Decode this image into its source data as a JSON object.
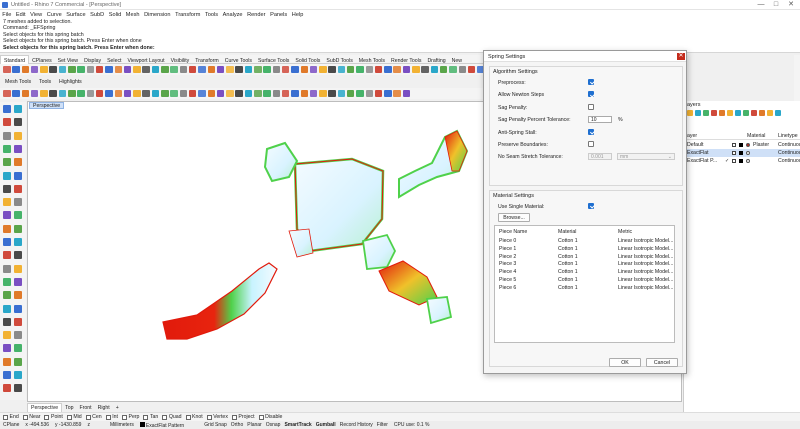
{
  "window": {
    "title": "Untitled - Rhino 7 Commercial - [Perspective]",
    "controls": [
      "—",
      "□",
      "✕"
    ]
  },
  "menu": [
    "File",
    "Edit",
    "View",
    "Curve",
    "Surface",
    "SubD",
    "Solid",
    "Mesh",
    "Dimension",
    "Transform",
    "Tools",
    "Analyze",
    "Render",
    "Panels",
    "Help"
  ],
  "command_history": [
    "7 meshes added to selection.",
    "Command: _EFSpring",
    "Select objects for this spring batch",
    "Select objects for this spring batch. Press Enter when done"
  ],
  "command_prompt": "Select objects for this spring batch. Press Enter when done:",
  "toolbar_tabs": [
    "Standard",
    "CPlanes",
    "Set View",
    "Display",
    "Select",
    "Viewport Layout",
    "Visibility",
    "Transform",
    "Curve Tools",
    "Surface Tools",
    "Solid Tools",
    "SubD Tools",
    "Mesh Tools",
    "Render Tools",
    "Drafting",
    "New"
  ],
  "toolbar_tabs2": [
    "Mesh Tools",
    "Tools",
    "Highlights"
  ],
  "viewport": {
    "label": "Perspective",
    "tabs": [
      "Perspective",
      "Top",
      "Front",
      "Right"
    ],
    "add_tab": "+"
  },
  "osnaps": [
    {
      "label": "End",
      "checked": false
    },
    {
      "label": "Near",
      "checked": false
    },
    {
      "label": "Point",
      "checked": false
    },
    {
      "label": "Mid",
      "checked": false
    },
    {
      "label": "Cen",
      "checked": false
    },
    {
      "label": "Int",
      "checked": false
    },
    {
      "label": "Perp",
      "checked": false
    },
    {
      "label": "Tan",
      "checked": false
    },
    {
      "label": "Quad",
      "checked": false
    },
    {
      "label": "Knot",
      "checked": false
    },
    {
      "label": "Vertex",
      "checked": false
    },
    {
      "label": "Project",
      "checked": false
    },
    {
      "label": "Disable",
      "checked": false
    }
  ],
  "status": {
    "cplane": "CPlane",
    "x": "x -494.536",
    "y": "y -1430.859",
    "z": "z",
    "units": "Millimeters",
    "layer": "ExactFlat Pattern",
    "toggles": [
      "Grid Snap",
      "Ortho",
      "Planar",
      "Osnap",
      "SmartTrack",
      "Gumball",
      "Record History",
      "Filter"
    ],
    "active_toggles": [
      "SmartTrack",
      "Gumball"
    ],
    "cpu": "CPU use: 0.1 %"
  },
  "layers_panel": {
    "title": "ayers",
    "columns": [
      "ayer",
      "Material",
      "Linetype"
    ],
    "rows": [
      {
        "name": "Default",
        "check": "",
        "material": "Plaster",
        "linetype": "Continuous",
        "selected": false
      },
      {
        "name": "ExactFlat",
        "check": "",
        "material": "",
        "linetype": "Continuous",
        "selected": true
      },
      {
        "name": "ExactFlat P...",
        "check": "✓",
        "material": "",
        "linetype": "Continuous",
        "selected": false
      }
    ]
  },
  "dialog": {
    "title": "Spring Settings",
    "close": "✕",
    "algorithm_group": "Algorithm Settings",
    "fields": [
      {
        "label": "Preprocess:",
        "kind": "checkbox",
        "checked": true
      },
      {
        "label": "Allow Newton Steps",
        "kind": "checkbox",
        "checked": true
      },
      {
        "label": "Sag Penalty:",
        "kind": "checkbox",
        "checked": false
      },
      {
        "label": "Sag Penalty Percent Tolerance:",
        "kind": "number",
        "value": "10",
        "unit": "%"
      },
      {
        "label": "Anti-Spring Stall:",
        "kind": "checkbox",
        "checked": true
      },
      {
        "label": "Preserve Boundaries:",
        "kind": "checkbox",
        "checked": false
      },
      {
        "label": "No Seam Stretch Tolerance:",
        "kind": "number",
        "value": "0.001",
        "unit": "mm"
      }
    ],
    "material_group": "Material Settings",
    "use_single_material": {
      "label": "Use Single Material:",
      "checked": true
    },
    "browse": "Browse...",
    "table_headers": [
      "Piece Name",
      "Material",
      "Metric"
    ],
    "table_rows": [
      [
        "Piece 0",
        "Cotton 1",
        "Linear Isotropic Model..."
      ],
      [
        "Piece 1",
        "Cotton 1",
        "Linear Isotropic Model..."
      ],
      [
        "Piece 2",
        "Cotton 1",
        "Linear Isotropic Model..."
      ],
      [
        "Piece 3",
        "Cotton 1",
        "Linear Isotropic Model..."
      ],
      [
        "Piece 4",
        "Cotton 1",
        "Linear Isotropic Model..."
      ],
      [
        "Piece 5",
        "Cotton 1",
        "Linear Isotropic Model..."
      ],
      [
        "Piece 6",
        "Cotton 1",
        "Linear Isotropic Model..."
      ]
    ],
    "ok": "OK",
    "cancel": "Cancel"
  },
  "colors": {
    "accent": "#1f6fd0",
    "close": "#c42b1c",
    "selection": "#cfe0f7",
    "mesh_high": "#e11a0c",
    "mesh_mid": "#4fd14a",
    "mesh_low": "#f4fbff"
  }
}
